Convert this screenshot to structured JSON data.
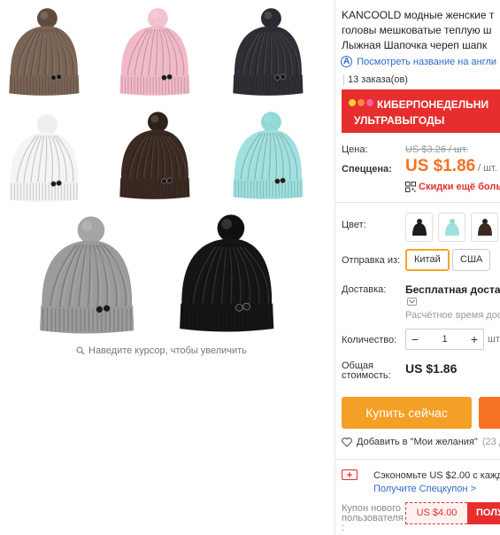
{
  "product": {
    "title_line1": "KANCOOLD модные женские т",
    "title_line2": "головы мешковатые теплую ш",
    "title_line3": "Лыжная Шапочка череп шапк",
    "translate_icon": "ai-translate-icon",
    "translate_link": "Посмотреть название на англи",
    "orders": "13 заказа(ов)"
  },
  "banner": {
    "line1": "КИБЕРПОНЕДЕЛЬНИ",
    "line2": "УЛЬТРАВЫГОДЫ",
    "dot_colors": [
      "#ffd233",
      "#ff8a3d",
      "#ff5fa2"
    ]
  },
  "price": {
    "label": "Цена:",
    "old": "US $3.26 / шт.",
    "special_label": "Спеццена:",
    "value": "US $1.86",
    "unit": "/ шт.",
    "discount_text": "Скидки ещё больш"
  },
  "options": {
    "color_label": "Цвет:",
    "color_swatches": [
      "black",
      "mint",
      "brown"
    ],
    "ship_from_label": "Отправка из:",
    "ship_from_options": [
      "Китай",
      "США"
    ],
    "ship_from_selected": "Китай"
  },
  "delivery": {
    "label": "Доставка:",
    "value": "Бесплатная доставка",
    "estimate": "Расчётное время доста"
  },
  "quantity": {
    "label": "Количество:",
    "minus": "−",
    "value": "1",
    "plus": "+",
    "unit": "шт."
  },
  "total": {
    "label_line1": "Общая",
    "label_line2": "стоимость:",
    "value": "US $1.86"
  },
  "actions": {
    "buy_now": "Купить сейчас",
    "wishlist_label": "Добавить в \"Мои желания\"",
    "wishlist_count": "(23 до"
  },
  "coupons": {
    "save_text": "Сэкономьте US $2.00 с кажды",
    "get_link": "Получите Спецкупон >",
    "new_user_label_1": "Купон нового",
    "new_user_label_2": "пользователя",
    "new_user_label_3": ":",
    "new_user_value": "US $4.00",
    "get_button": "ПОЛУ"
  },
  "gallery": {
    "zoom_hint": "Наведите курсор, чтобы увеличить",
    "hats": [
      {
        "name": "hat-brown",
        "body": "#7a6455",
        "pompom": "#5f4c3f"
      },
      {
        "name": "hat-pink",
        "body": "#f1b9c8",
        "pompom": "#f3c2cf"
      },
      {
        "name": "hat-dark-grey",
        "body": "#2f2f36",
        "pompom": "#2a2a30"
      },
      {
        "name": "hat-white",
        "body": "#f4f4f2",
        "pompom": "#eeeeec"
      },
      {
        "name": "hat-chocolate",
        "body": "#3b2a22",
        "pompom": "#2f2119"
      },
      {
        "name": "hat-mint",
        "body": "#9fe0de",
        "pompom": "#8fd9d6"
      },
      {
        "name": "hat-grey",
        "body": "#9b9b9b",
        "pompom": "#a5a5a5"
      },
      {
        "name": "hat-black",
        "body": "#151515",
        "pompom": "#101010"
      }
    ]
  },
  "colors": {
    "accent_orange": "#f49f26",
    "price_orange": "#f57224",
    "sale_red": "#e62e2e",
    "link_blue": "#2e6bc4"
  }
}
